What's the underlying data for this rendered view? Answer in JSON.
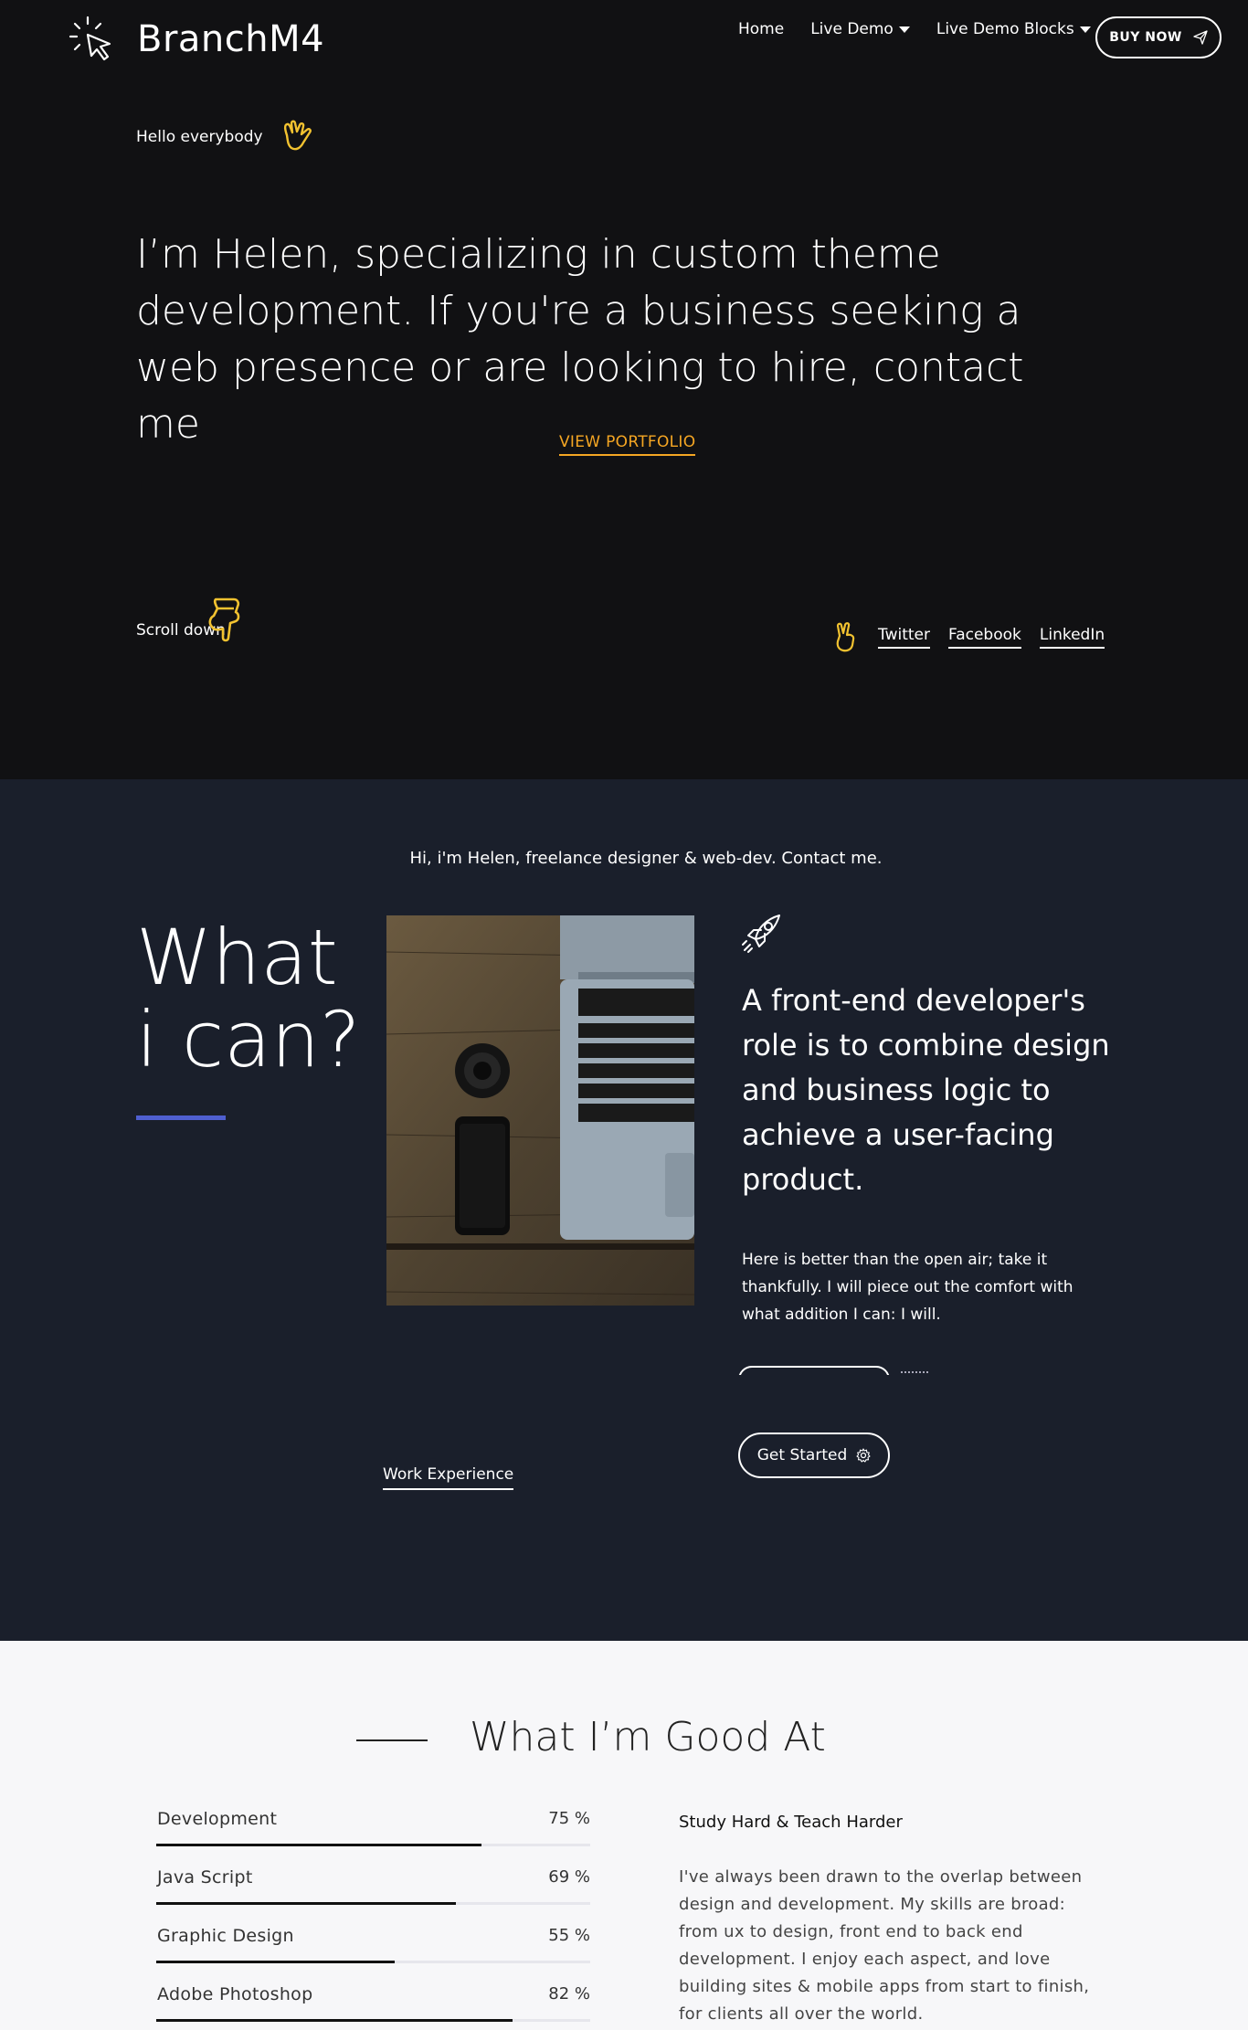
{
  "header": {
    "brand": "BranchM4",
    "nav": [
      {
        "label": "Home"
      },
      {
        "label": "Live Demo"
      },
      {
        "label": "Live Demo Blocks"
      }
    ],
    "buy_label": "BUY NOW"
  },
  "hero": {
    "hello": "Hello everybody",
    "headline": "I’m Helen, specializing in custom theme development. If you're a business seeking a web presence or are looking to hire, contact me",
    "view_portfolio": "VIEW PORTFOLIO",
    "scroll_down": "Scroll down",
    "social": [
      {
        "label": "Twitter"
      },
      {
        "label": "Facebook"
      },
      {
        "label": "LinkedIn"
      }
    ]
  },
  "about": {
    "intro": "Hi, i'm Helen, freelance designer & web-dev. Contact me.",
    "title_line1": "What",
    "title_line2": "i can?",
    "work_experience": "Work Experience",
    "dev_text": "A front-end developer's role is to combine design and business logic to achieve a user-facing product.",
    "dev_sub": "Here is better than the open air; take it thankfully. I will piece out the comfort with what addition I can: I will.",
    "get_started": "Get Started"
  },
  "skills_section": {
    "title": "What I’m Good At",
    "skills": [
      {
        "name": "Development",
        "pct": "75 %",
        "value": 0.75
      },
      {
        "name": "Java Script",
        "pct": "69 %",
        "value": 0.69
      },
      {
        "name": "Graphic Design",
        "pct": "55 %",
        "value": 0.55
      },
      {
        "name": "Adobe Photoshop",
        "pct": "82 %",
        "value": 0.82
      }
    ],
    "study_title": "Study Hard & Teach Harder",
    "study_text": "I've always been drawn to the overlap between design and development. My skills are broad: from ux to design, front end to back end development. I enjoy each aspect, and love building sites & mobile apps from start to finish, for clients all over the world."
  },
  "colors": {
    "hero_bg": "#111113",
    "section_bg": "#1a1f2b",
    "accent_orange": "#f5a623",
    "accent_blue": "#4f5fd0",
    "icon_yellow": "#f2c230"
  }
}
